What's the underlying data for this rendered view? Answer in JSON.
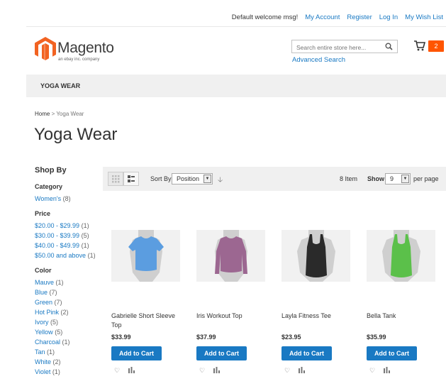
{
  "header": {
    "welcome": "Default welcome msg!",
    "links": [
      "My Account",
      "Register",
      "Log In",
      "My Wish List"
    ],
    "logo_word": "Magento",
    "logo_sub": "an ebay inc. company",
    "search_placeholder": "Search entire store here...",
    "advanced_search": "Advanced Search",
    "cart_count": "2"
  },
  "nav": {
    "item": "YOGA WEAR"
  },
  "breadcrumb": {
    "home": "Home",
    "sep": ">",
    "current": "Yoga Wear"
  },
  "page_title": "Yoga Wear",
  "sidebar": {
    "title": "Shop By",
    "groups": [
      {
        "title": "Category",
        "items": [
          {
            "label": "Women's",
            "count": "(8)"
          }
        ]
      },
      {
        "title": "Price",
        "items": [
          {
            "label": "$20.00 - $29.99",
            "count": "(1)"
          },
          {
            "label": "$30.00 - $39.99",
            "count": "(5)"
          },
          {
            "label": "$40.00 - $49.99",
            "count": "(1)"
          },
          {
            "label": "$50.00 and above",
            "count": "(1)"
          }
        ]
      },
      {
        "title": "Color",
        "items": [
          {
            "label": "Mauve",
            "count": "(1)"
          },
          {
            "label": "Blue",
            "count": "(7)"
          },
          {
            "label": "Green",
            "count": "(7)"
          },
          {
            "label": "Hot Pink",
            "count": "(2)"
          },
          {
            "label": "Ivory",
            "count": "(5)"
          },
          {
            "label": "Yellow",
            "count": "(5)"
          },
          {
            "label": "Charcoal",
            "count": "(1)"
          },
          {
            "label": "Tan",
            "count": "(1)"
          },
          {
            "label": "White",
            "count": "(2)"
          },
          {
            "label": "Violet",
            "count": "(1)"
          }
        ]
      }
    ]
  },
  "toolbar": {
    "sort_label": "Sort By",
    "sort_value": "Position",
    "items": "8 Item",
    "show_label": "Show",
    "show_value": "9",
    "per_page": "per page"
  },
  "products": [
    {
      "name": "Gabrielle Short Sleeve Top",
      "price": "$33.99",
      "button": "Add to Cart",
      "color": "#5b9de0",
      "style": "tee"
    },
    {
      "name": "Iris Workout Top",
      "price": "$37.99",
      "button": "Add to Cart",
      "color": "#9c6791",
      "style": "long"
    },
    {
      "name": "Layla Fitness Tee",
      "price": "$23.95",
      "button": "Add to Cart",
      "color": "#2a2a2a",
      "style": "tank"
    },
    {
      "name": "Bella Tank",
      "price": "$35.99",
      "button": "Add to Cart",
      "color": "#5bc04a",
      "style": "tank"
    }
  ],
  "colors": {
    "link": "#1979c3",
    "accent": "#ff5501",
    "button": "#1979c3"
  }
}
